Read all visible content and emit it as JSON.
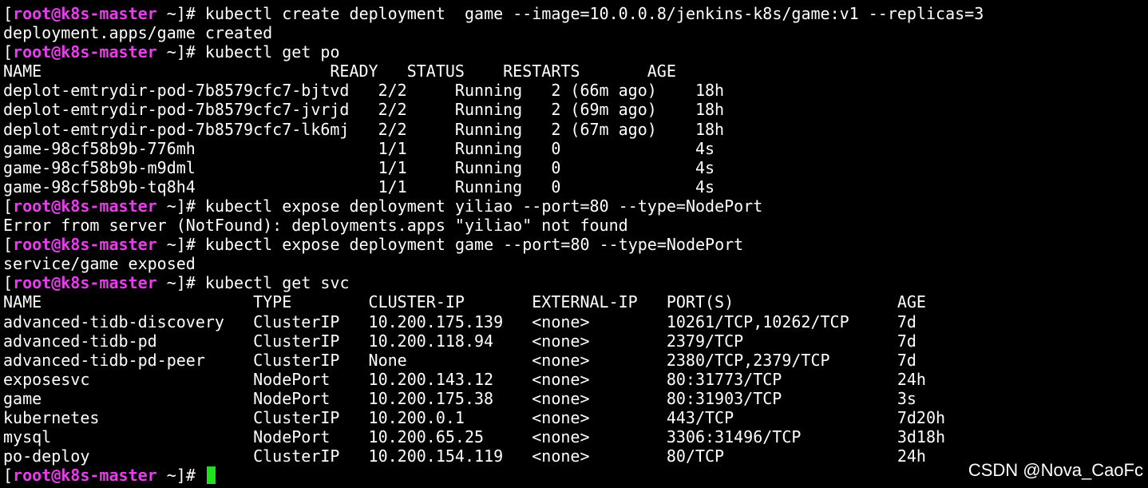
{
  "prompt": {
    "open_bracket": "[",
    "user": "root",
    "at": "@",
    "host": "k8s-master",
    "dir": " ~",
    "close": "]# "
  },
  "lines": [
    {
      "type": "cmd",
      "text": "kubectl create deployment  game --image=10.0.0.8/jenkins-k8s/game:v1 --replicas=3"
    },
    {
      "type": "out",
      "text": "deployment.apps/game created"
    },
    {
      "type": "cmd",
      "text": "kubectl get po"
    },
    {
      "type": "out",
      "text": "NAME                              READY   STATUS    RESTARTS       AGE"
    },
    {
      "type": "out",
      "text": "deplot-emtrydir-pod-7b8579cfc7-bjtvd   2/2     Running   2 (66m ago)    18h"
    },
    {
      "type": "out",
      "text": "deplot-emtrydir-pod-7b8579cfc7-jvrjd   2/2     Running   2 (69m ago)    18h"
    },
    {
      "type": "out",
      "text": "deplot-emtrydir-pod-7b8579cfc7-lk6mj   2/2     Running   2 (67m ago)    18h"
    },
    {
      "type": "out",
      "text": "game-98cf58b9b-776mh                   1/1     Running   0              4s"
    },
    {
      "type": "out",
      "text": "game-98cf58b9b-m9dml                   1/1     Running   0              4s"
    },
    {
      "type": "out",
      "text": "game-98cf58b9b-tq8h4                   1/1     Running   0              4s"
    },
    {
      "type": "cmd",
      "text": "kubectl expose deployment yiliao --port=80 --type=NodePort"
    },
    {
      "type": "out",
      "text": "Error from server (NotFound): deployments.apps \"yiliao\" not found"
    },
    {
      "type": "cmd",
      "text": "kubectl expose deployment game --port=80 --type=NodePort"
    },
    {
      "type": "out",
      "text": "service/game exposed"
    },
    {
      "type": "cmd",
      "text": "kubectl get svc"
    },
    {
      "type": "out",
      "text": "NAME                      TYPE        CLUSTER-IP       EXTERNAL-IP   PORT(S)                 AGE"
    },
    {
      "type": "out",
      "text": "advanced-tidb-discovery   ClusterIP   10.200.175.139   <none>        10261/TCP,10262/TCP     7d"
    },
    {
      "type": "out",
      "text": "advanced-tidb-pd          ClusterIP   10.200.118.94    <none>        2379/TCP                7d"
    },
    {
      "type": "out",
      "text": "advanced-tidb-pd-peer     ClusterIP   None             <none>        2380/TCP,2379/TCP       7d"
    },
    {
      "type": "out",
      "text": "exposesvc                 NodePort    10.200.143.12    <none>        80:31773/TCP            24h"
    },
    {
      "type": "out",
      "text": "game                      NodePort    10.200.175.38    <none>        80:31903/TCP            3s"
    },
    {
      "type": "out",
      "text": "kubernetes                ClusterIP   10.200.0.1       <none>        443/TCP                 7d20h"
    },
    {
      "type": "out",
      "text": "mysql                     NodePort    10.200.65.25     <none>        3306:31496/TCP          3d18h"
    },
    {
      "type": "out",
      "text": "po-deploy                 ClusterIP   10.200.154.119   <none>        80/TCP                  24h"
    },
    {
      "type": "cmd",
      "text": ""
    }
  ],
  "watermark": "CSDN @Nova_CaoFc",
  "colors": {
    "background": "#000000",
    "text": "#ffffff",
    "prompt_user_host": "#e93dec",
    "cursor": "#20e020"
  }
}
